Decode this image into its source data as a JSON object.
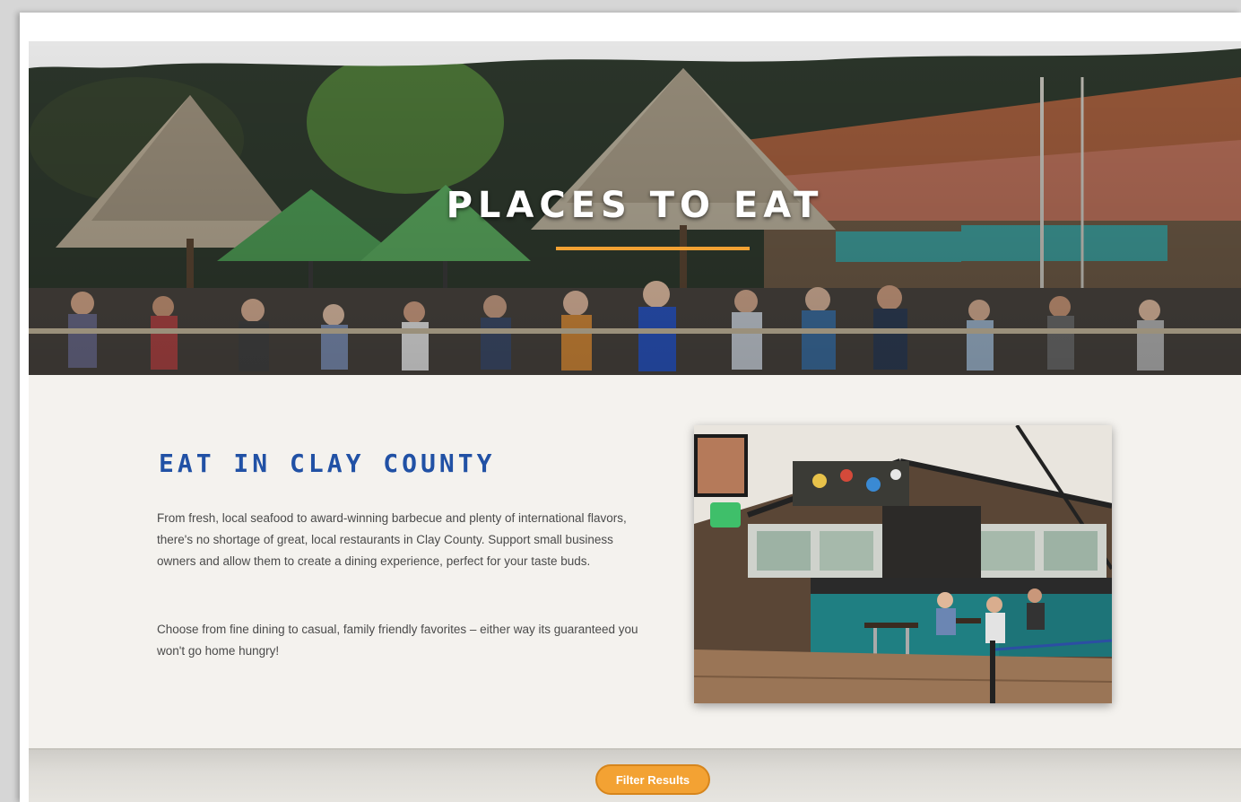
{
  "hero": {
    "title": "PLACES TO EAT",
    "accent_color": "#f3a233",
    "image": "outdoor-tiki-bar-dining-photo"
  },
  "intro": {
    "heading": "EAT IN CLAY COUNTY",
    "heading_color": "#2151a5",
    "paragraphs": [
      "From fresh, local seafood to award-winning barbecue and plenty of international flavors, there's no shortage of great, local restaurants in Clay County. Support small business owners and allow them to create a dining experience, perfect for your taste buds.",
      "Choose from fine dining to casual, family friendly favorites – either way its guaranteed you won't go home hungry!"
    ],
    "image": "restaurant-interior-photo"
  },
  "filter": {
    "button_label": "Filter Results",
    "button_color": "#f3a233"
  }
}
